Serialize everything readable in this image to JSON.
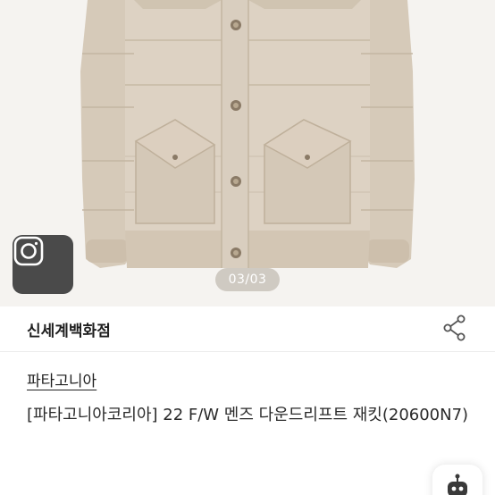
{
  "gallery": {
    "indicator": "03/03",
    "product_color": "#d8cdbe"
  },
  "seller": {
    "name": "신세계백화점"
  },
  "product": {
    "brand": "파타고니아",
    "title": "[파타고니아코리아] 22 F/W 멘즈 다운드리프트 재킷(20600N7)"
  },
  "icons": {
    "camera": "camera-icon",
    "share": "share-icon",
    "chatbot": "robot-icon"
  }
}
